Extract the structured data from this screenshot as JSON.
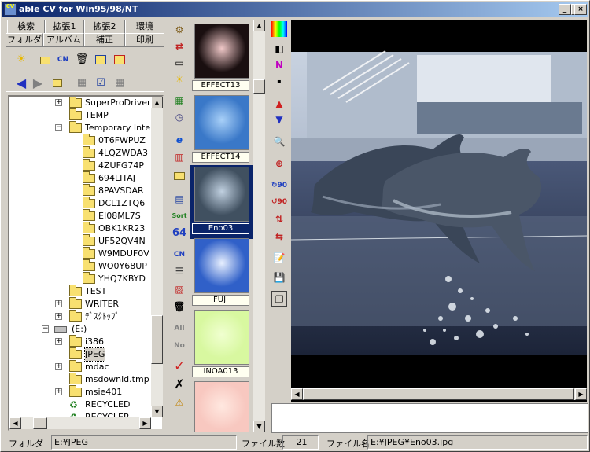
{
  "window": {
    "title": "able CV for Win95/98/NT",
    "icon_label": "able CV",
    "controls": {
      "minimize": "_",
      "maximize": "□",
      "close": "×"
    }
  },
  "tabs": {
    "row1": [
      "検索",
      "拡張1",
      "拡張2",
      "環境"
    ],
    "row2": [
      "フォルダ",
      "アルバム",
      "補正",
      "印刷"
    ]
  },
  "folder_toolbar": {
    "row1_icons": [
      "sun-icon",
      "folder-icon",
      "cn-icon",
      "trash-icon",
      "windows-icon",
      "windows-red-icon"
    ],
    "row2_icons": [
      "back-arrow-icon",
      "forward-arrow-icon",
      "folders-icon",
      "disk-icon",
      "checklist-icon",
      "grid-icon"
    ]
  },
  "tree": {
    "items": [
      {
        "label": "SuperProDriver",
        "indent": 1,
        "expander": "+"
      },
      {
        "label": "TEMP",
        "indent": 1,
        "expander": ""
      },
      {
        "label": "Temporary Internet",
        "indent": 1,
        "expander": "−"
      },
      {
        "label": "0T6FWPUZ",
        "indent": 2,
        "expander": ""
      },
      {
        "label": "4LQZWDA3",
        "indent": 2,
        "expander": ""
      },
      {
        "label": "4ZUFG74P",
        "indent": 2,
        "expander": ""
      },
      {
        "label": "694LITAJ",
        "indent": 2,
        "expander": ""
      },
      {
        "label": "8PAVSDAR",
        "indent": 2,
        "expander": ""
      },
      {
        "label": "DCL1ZTQ6",
        "indent": 2,
        "expander": ""
      },
      {
        "label": "EI08ML7S",
        "indent": 2,
        "expander": ""
      },
      {
        "label": "OBK1KR23",
        "indent": 2,
        "expander": ""
      },
      {
        "label": "UF52QV4N",
        "indent": 2,
        "expander": ""
      },
      {
        "label": "W9MDUF0V",
        "indent": 2,
        "expander": ""
      },
      {
        "label": "WO0Y68UP",
        "indent": 2,
        "expander": ""
      },
      {
        "label": "YHQ7KBYD",
        "indent": 2,
        "expander": ""
      },
      {
        "label": "TEST",
        "indent": 1,
        "expander": ""
      },
      {
        "label": "WRITER",
        "indent": 1,
        "expander": "+"
      },
      {
        "label": "ﾃﾞｽｸﾄｯﾌﾟ",
        "indent": 1,
        "expander": "+"
      },
      {
        "label": "(E:)",
        "indent": 0,
        "expander": "−"
      },
      {
        "label": "i386",
        "indent": 1,
        "expander": "+"
      },
      {
        "label": "JPEG",
        "indent": 1,
        "expander": "",
        "selected": true
      },
      {
        "label": "mdac",
        "indent": 1,
        "expander": "+"
      },
      {
        "label": "msdownld.tmp",
        "indent": 1,
        "expander": ""
      },
      {
        "label": "msie401",
        "indent": 1,
        "expander": "+"
      },
      {
        "label": "RECYCLED",
        "indent": 1,
        "expander": ""
      },
      {
        "label": "RECYCLER",
        "indent": 1,
        "expander": ""
      }
    ]
  },
  "thumbnails": [
    {
      "label": "EFFECT13",
      "color": "#1a0f10",
      "accent": "#f0c8c8",
      "selected": false
    },
    {
      "label": "EFFECT14",
      "color": "#3a78c8",
      "accent": "#a8d0f8",
      "selected": false
    },
    {
      "label": "Eno03",
      "color": "#405060",
      "accent": "#c0d0e0",
      "selected": true
    },
    {
      "label": "FUJI",
      "color": "#3060c8",
      "accent": "#e8f0ff",
      "selected": false
    },
    {
      "label": "INOA013",
      "color": "#d8f8a0",
      "accent": "#f0ffd0",
      "selected": false
    },
    {
      "label": "",
      "color": "#f8c8c0",
      "accent": "#ffe8e0",
      "selected": false
    }
  ],
  "status": {
    "folder_label": "フォルダ",
    "folder_value": "E:¥JPEG",
    "count_label": "ファイル数",
    "count_value": "21",
    "filename_label": "ファイル名",
    "filename_value": "E:¥JPEG¥Eno03.jpg"
  }
}
